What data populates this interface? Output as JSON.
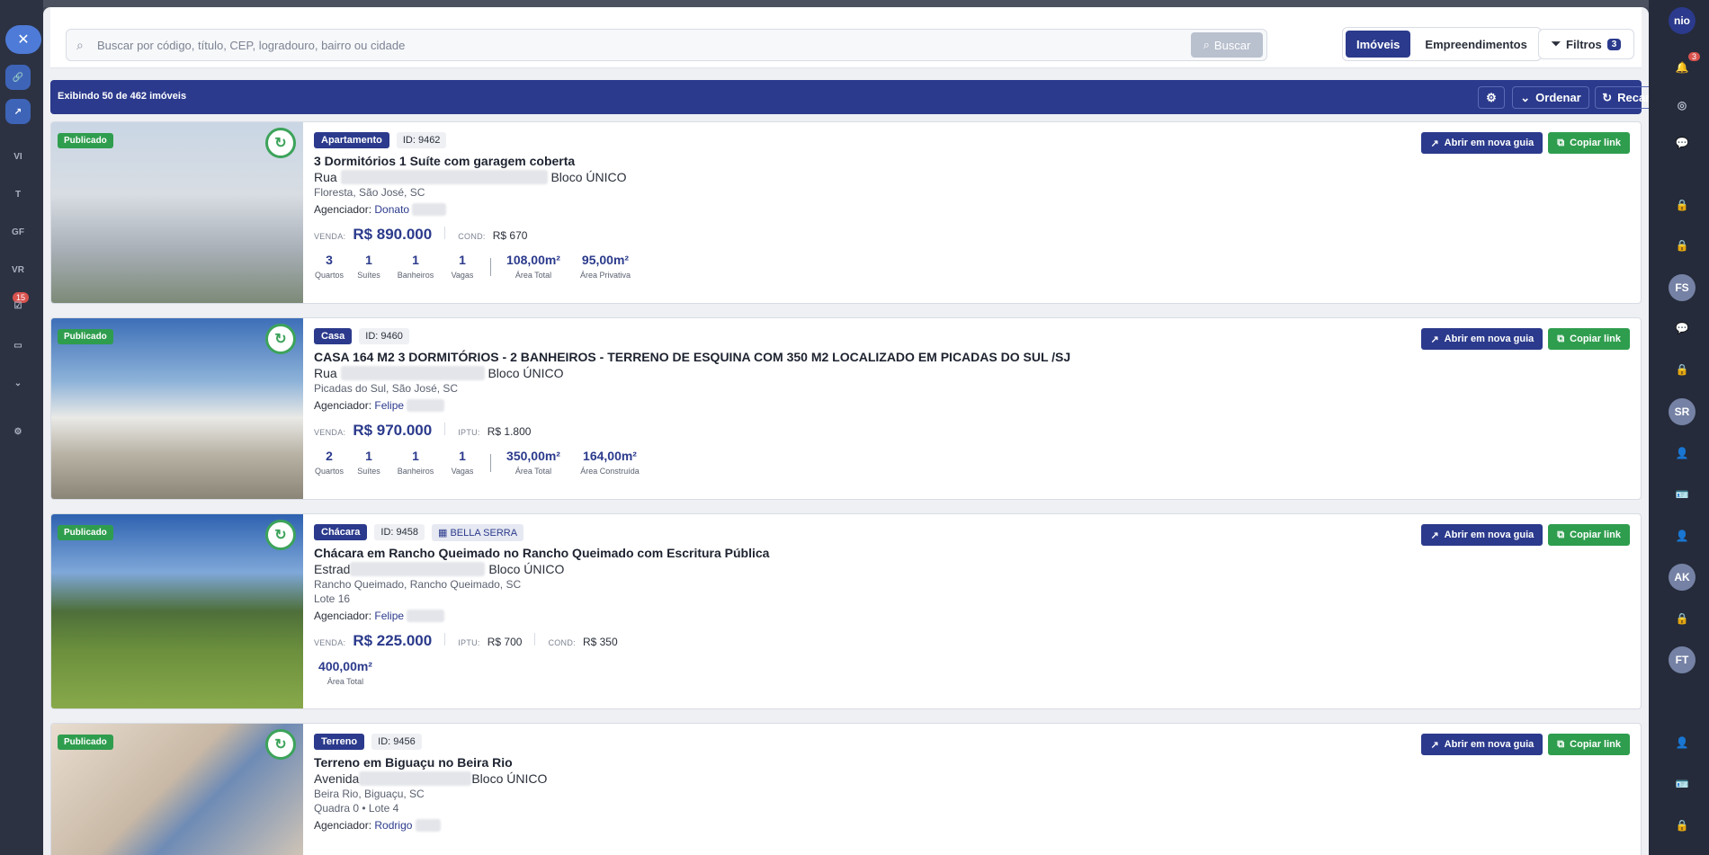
{
  "search": {
    "placeholder": "Buscar por código, título, CEP, logradouro, bairro ou cidade",
    "button_label": "Buscar"
  },
  "segment": {
    "tabs": [
      "Imóveis",
      "Empreendimentos"
    ],
    "active": "Imóveis"
  },
  "filters": {
    "label": "Filtros",
    "count": "3"
  },
  "toolbar": {
    "summary": "Exibindo 50 de 462 imóveis",
    "order_label": "Ordenar",
    "reload_label": "Recarregar"
  },
  "left_rail": {
    "items": [
      "VI",
      "T",
      "GF",
      "VR"
    ],
    "badge": "15"
  },
  "right_rail": {
    "user": "nio",
    "notif_badge": "3",
    "avatars": [
      "FS",
      "SR",
      "AK",
      "FT"
    ]
  },
  "card_actions": {
    "open_label": "Abrir em nova guia",
    "copy_label": "Copiar link"
  },
  "listings": [
    {
      "status": "Publicado",
      "type": "Apartamento",
      "id": "ID: 9462",
      "condo": "",
      "title": "3 Dormitórios 1 Suíte com garagem coberta",
      "street_prefix": "Rua",
      "street_suffix": "Bloco ÚNICO",
      "neighborhood": "Floresta, São José, SC",
      "lot": "",
      "agent_label": "Agenciador:",
      "agent": "Donato",
      "price_label": "VENDA:",
      "price": "R$ 890.000",
      "fees": [
        {
          "label": "COND:",
          "value": "R$ 670"
        }
      ],
      "stats": [
        {
          "num": "3",
          "label": "Quartos"
        },
        {
          "num": "1",
          "label": "Suítes"
        },
        {
          "num": "1",
          "label": "Banheiros"
        },
        {
          "num": "1",
          "label": "Vagas"
        }
      ],
      "areas": [
        {
          "num": "108,00m²",
          "label": "Área Total"
        },
        {
          "num": "95,00m²",
          "label": "Área Privativa"
        }
      ]
    },
    {
      "status": "Publicado",
      "type": "Casa",
      "id": "ID: 9460",
      "condo": "",
      "title": "CASA 164 M2 3 DORMITÓRIOS - 2 BANHEIROS - TERRENO DE ESQUINA COM 350 M2 LOCALIZADO EM PICADAS DO SUL /SJ",
      "street_prefix": "Rua",
      "street_suffix": "Bloco ÚNICO",
      "neighborhood": "Picadas do Sul, São José, SC",
      "lot": "",
      "agent_label": "Agenciador:",
      "agent": "Felipe",
      "price_label": "VENDA:",
      "price": "R$ 970.000",
      "fees": [
        {
          "label": "IPTU:",
          "value": "R$ 1.800"
        }
      ],
      "stats": [
        {
          "num": "2",
          "label": "Quartos"
        },
        {
          "num": "1",
          "label": "Suítes"
        },
        {
          "num": "1",
          "label": "Banheiros"
        },
        {
          "num": "1",
          "label": "Vagas"
        }
      ],
      "areas": [
        {
          "num": "350,00m²",
          "label": "Área Total"
        },
        {
          "num": "164,00m²",
          "label": "Área Construída"
        }
      ]
    },
    {
      "status": "Publicado",
      "type": "Chácara",
      "id": "ID: 9458",
      "condo": "BELLA SERRA",
      "title": "Chácara em Rancho Queimado no Rancho Queimado com Escritura Pública",
      "street_prefix": "Estrad",
      "street_suffix": "Bloco ÚNICO",
      "neighborhood": "Rancho Queimado, Rancho Queimado, SC",
      "lot": "Lote 16",
      "agent_label": "Agenciador:",
      "agent": "Felipe",
      "price_label": "VENDA:",
      "price": "R$ 225.000",
      "fees": [
        {
          "label": "IPTU:",
          "value": "R$ 700"
        },
        {
          "label": "COND:",
          "value": "R$ 350"
        }
      ],
      "stats": [],
      "areas": [
        {
          "num": "400,00m²",
          "label": "Área Total"
        }
      ]
    },
    {
      "status": "Publicado",
      "type": "Terreno",
      "id": "ID: 9456",
      "condo": "",
      "title": "Terreno em Biguaçu no Beira Rio",
      "street_prefix": "Avenida",
      "street_suffix": "Bloco ÚNICO",
      "neighborhood": "Beira Rio, Biguaçu, SC",
      "lot": "Quadra 0 • Lote 4",
      "agent_label": "Agenciador:",
      "agent": "Rodrigo",
      "price_label": "",
      "price": "",
      "fees": [],
      "stats": [],
      "areas": []
    }
  ]
}
